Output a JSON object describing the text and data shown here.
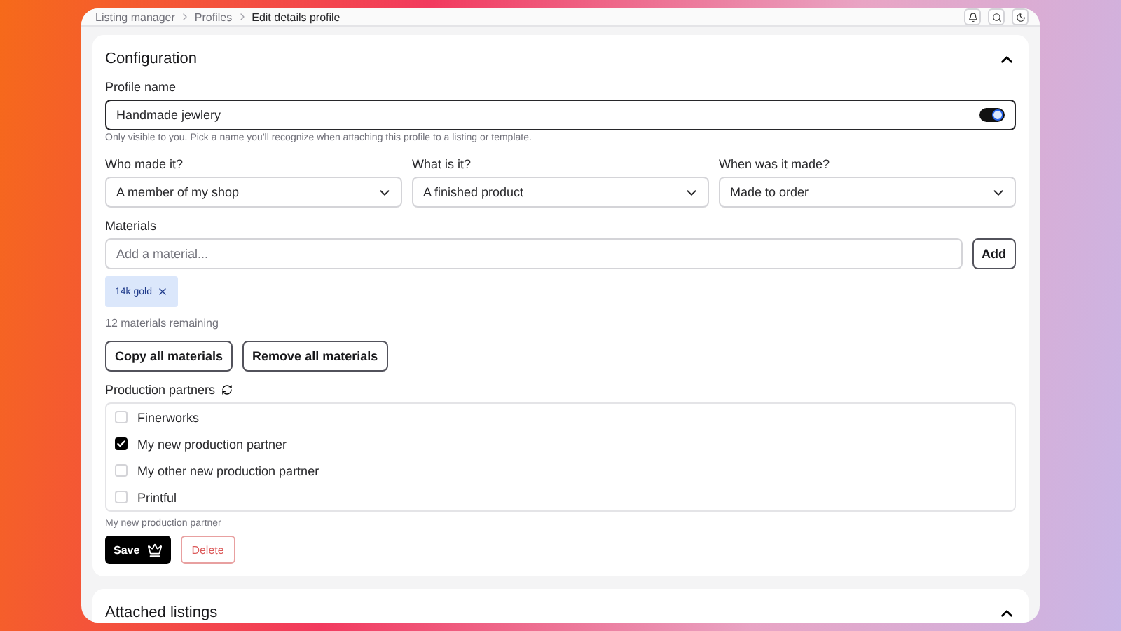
{
  "breadcrumbs": [
    "Listing manager",
    "Profiles",
    "Edit details profile"
  ],
  "configuration": {
    "title": "Configuration",
    "expanded": true,
    "profile_name": {
      "label": "Profile name",
      "value": "Handmade jewlery",
      "hint": "Only visible to you. Pick a name you'll recognize when attaching this profile to a listing or template."
    },
    "selects": [
      {
        "label": "Who made it?",
        "value": "A member of my shop"
      },
      {
        "label": "What is it?",
        "value": "A finished product"
      },
      {
        "label": "When was it made?",
        "value": "Made to order"
      }
    ],
    "materials": {
      "label": "Materials",
      "placeholder": "Add a material...",
      "add_button": "Add",
      "tags": [
        "14k gold"
      ],
      "remaining": "12 materials remaining",
      "buttons": [
        "Copy all materials",
        "Remove all materials"
      ]
    },
    "production_partners": {
      "label": "Production partners",
      "options": [
        {
          "label": "Finerworks",
          "checked": false
        },
        {
          "label": "My new production partner",
          "checked": true
        },
        {
          "label": "My other new production partner",
          "checked": false
        },
        {
          "label": "Printful",
          "checked": false
        }
      ],
      "summary": "My new production partner"
    },
    "save_button": "Save",
    "delete_button": "Delete"
  },
  "attached_listings": {
    "title": "Attached listings",
    "expanded": true
  }
}
